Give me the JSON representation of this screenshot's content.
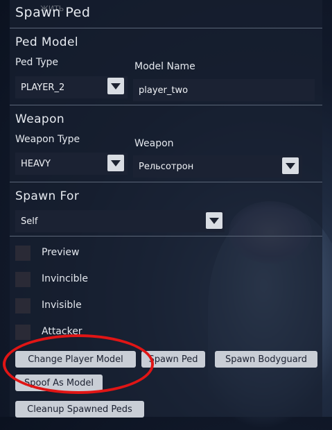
{
  "window": {
    "title": "Spawn Ped",
    "ghost_text": "ЖИТЬ"
  },
  "ped_model": {
    "section_label": "Ped Model",
    "ped_type_label": "Ped Type",
    "ped_type_value": "PLAYER_2",
    "model_name_label": "Model Name",
    "model_name_value": "player_two"
  },
  "weapon": {
    "section_label": "Weapon",
    "weapon_type_label": "Weapon Type",
    "weapon_type_value": "HEAVY",
    "weapon_label": "Weapon",
    "weapon_value": "Рельсотрон"
  },
  "spawn_for": {
    "section_label": "Spawn For",
    "value": "Self"
  },
  "options": [
    {
      "label": "Preview",
      "checked": false
    },
    {
      "label": "Invincible",
      "checked": false
    },
    {
      "label": "Invisible",
      "checked": false
    },
    {
      "label": "Attacker",
      "checked": false
    }
  ],
  "buttons": {
    "change_player_model": "Change Player Model",
    "spawn_ped": "Spawn Ped",
    "spawn_bodyguard": "Spawn Bodyguard",
    "spoof_as_model": "Spoof As Model",
    "cleanup_spawned_peds": "Cleanup Spawned Peds"
  },
  "colors": {
    "annotation": "#e01515",
    "button_bg": "#c9ced6",
    "panel_bg": "#182030"
  }
}
